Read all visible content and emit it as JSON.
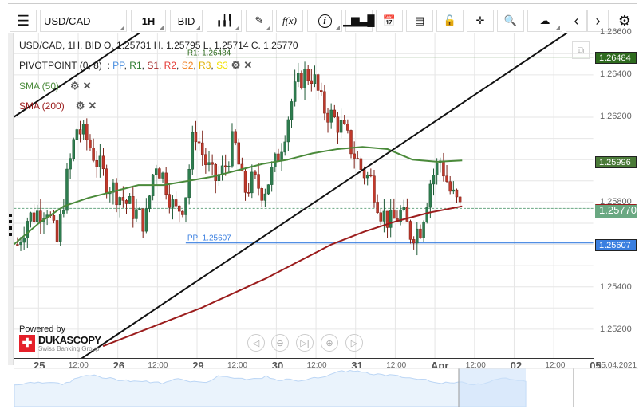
{
  "toolbar": {
    "symbol": "USD/CAD",
    "timeframe": "1H",
    "side": "BID",
    "fx_label": "f(x)",
    "info_label": "i"
  },
  "legend": {
    "ohlc": "USD/CAD, 1H, BID   O. 1.25731 H. 1.25795 L. 1.25714 C. 1.25770",
    "pivot_name": "PIVOTPOINT (0, 8)",
    "pivot_items": [
      {
        "t": "PP",
        "c": "#4a8fe0"
      },
      {
        "t": "R1",
        "c": "#2e7d32"
      },
      {
        "t": "S1",
        "c": "#a52a2a"
      },
      {
        "t": "R2",
        "c": "#e53935"
      },
      {
        "t": "S2",
        "c": "#f08020"
      },
      {
        "t": "R3",
        "c": "#e0b000"
      },
      {
        "t": "S3",
        "c": "#f2e000"
      }
    ],
    "sma50": "SMA (50)",
    "sma200": "SMA (200)"
  },
  "chart_data": {
    "type": "candlestick",
    "symbol": "USD/CAD",
    "timeframe": "1H",
    "ylim": [
      1.2515,
      1.2666
    ],
    "y_ticks": [
      "1.26600",
      "1.26400",
      "1.26200",
      "1.25800",
      "1.25400",
      "1.25200"
    ],
    "x_labels": [
      {
        "t": "25",
        "big": true
      },
      {
        "t": "12:00"
      },
      {
        "t": "26",
        "big": true
      },
      {
        "t": "12:00"
      },
      {
        "t": "29",
        "big": true
      },
      {
        "t": "12:00"
      },
      {
        "t": "30",
        "big": true
      },
      {
        "t": "12:00"
      },
      {
        "t": "31",
        "big": true
      },
      {
        "t": "12:00"
      },
      {
        "t": "Apr",
        "big": true
      },
      {
        "t": "12:00"
      },
      {
        "t": "02",
        "big": true
      },
      {
        "t": "12:00"
      },
      {
        "t": "05",
        "big": true
      }
    ],
    "date_label": "05.04.2021",
    "close_path": [
      1.256,
      1.2572,
      1.2575,
      1.2578,
      1.256,
      1.259,
      1.2615,
      1.261,
      1.26,
      1.259,
      1.2585,
      1.258,
      1.2575,
      1.257,
      1.26,
      1.259,
      1.2575,
      1.258,
      1.2615,
      1.26,
      1.259,
      1.2595,
      1.261,
      1.2585,
      1.259,
      1.2585,
      1.2595,
      1.261,
      1.263,
      1.264,
      1.264,
      1.2625,
      1.262,
      1.2615,
      1.2605,
      1.2595,
      1.259,
      1.2575,
      1.257,
      1.2575,
      1.2565,
      1.2568,
      1.259,
      1.26,
      1.2585,
      1.2577
    ],
    "sma50_path": [
      1.256,
      1.257,
      1.2578,
      1.2582,
      1.2585,
      1.2588,
      1.2588,
      1.259,
      1.2592,
      1.2595,
      1.2598,
      1.26,
      1.2603,
      1.2605,
      1.2606,
      1.2605,
      1.26,
      1.2599,
      1.25996
    ],
    "sma200_path": [
      1.2512,
      1.2518,
      1.2524,
      1.253,
      1.2537,
      1.2544,
      1.2552,
      1.256,
      1.2566,
      1.2571,
      1.2575,
      1.2578
    ],
    "levels": {
      "R1": {
        "label": "R1: 1.26484",
        "value": 1.26484,
        "badge": "1.26484"
      },
      "PP": {
        "label": "PP: 1.25607",
        "value": 1.25607,
        "badge": "1.25607"
      },
      "sma50_badge": "1.25996",
      "last_badge": "1.25770",
      "last": 1.2577,
      "sma50_last": 1.25996
    }
  },
  "branding": {
    "powered_by": "Powered by",
    "logo": "DUKASCOPY",
    "tagline": "Swiss Banking Group"
  },
  "colors": {
    "up": "#2e7d4f",
    "down": "#c0392b",
    "sma50": "#4a8a3a",
    "sma200": "#9b1c1c",
    "r1": "#2e6b1e",
    "pp": "#3a7fe0"
  }
}
